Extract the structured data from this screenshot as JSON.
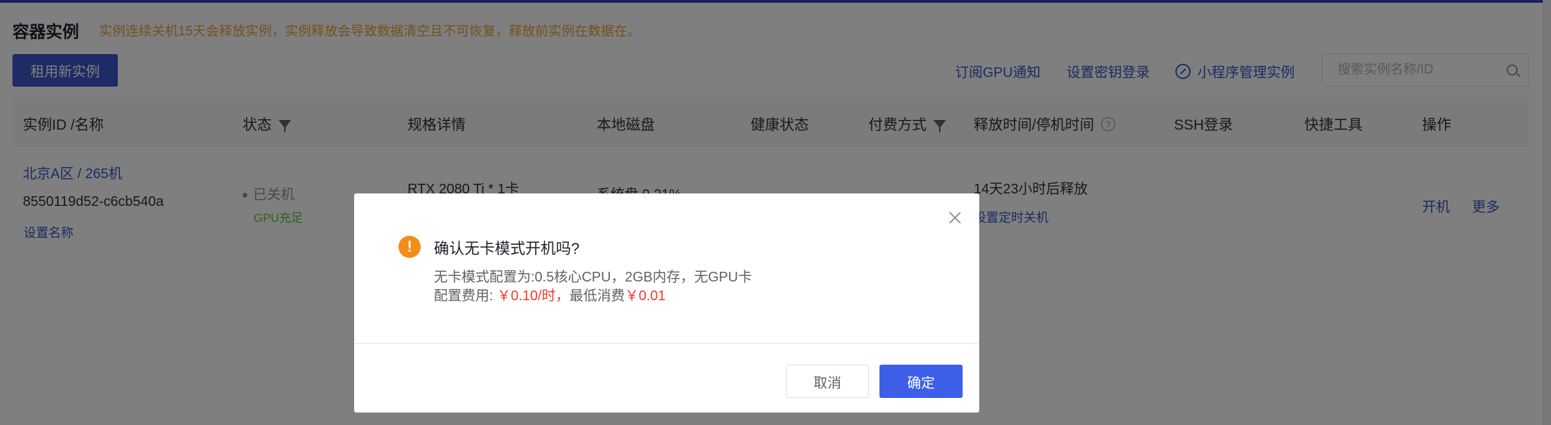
{
  "header": {
    "title": "容器实例",
    "warning": "实例连续关机15天会释放实例，实例释放会导致数据清空且不可恢复，释放前实例在数据在。"
  },
  "toolbar": {
    "rent_button": "租用新实例",
    "gpu_notify": "订阅GPU通知",
    "key_login": "设置密钥登录",
    "mini_program": "小程序管理实例",
    "search_placeholder": "搜索实例名称/ID"
  },
  "table": {
    "columns": [
      "实例ID /名称",
      "状态",
      "规格详情",
      "本地磁盘",
      "健康状态",
      "付费方式",
      "释放时间/停机时间",
      "SSH登录",
      "快捷工具",
      "操作"
    ],
    "rows": [
      {
        "name": "北京A区 / 265机",
        "id": "8550119d52-c6cb540a",
        "set_name": "设置名称",
        "status": "已关机",
        "gpu_status": "GPU充足",
        "spec": "RTX 2080 Ti * 1卡",
        "disk": "系统盘 0.21%",
        "release_time": "14天23小时后释放",
        "schedule_shutdown": "设置定时关机",
        "action_start": "开机",
        "action_more": "更多"
      }
    ]
  },
  "modal": {
    "title": "确认无卡模式开机吗?",
    "line1": "无卡模式配置为:0.5核心CPU，2GB内存，无GPU卡",
    "line2_prefix": "配置费用: ",
    "price_hour": "￥0.10/时，",
    "line2_mid": "最低消费",
    "price_min": "￥0.01",
    "cancel": "取消",
    "confirm": "确定"
  },
  "colors": {
    "primary": "#3d56c9",
    "link": "#3456c5",
    "warning": "#e6a23c",
    "price": "#f03b2e",
    "success": "#67c23a"
  }
}
